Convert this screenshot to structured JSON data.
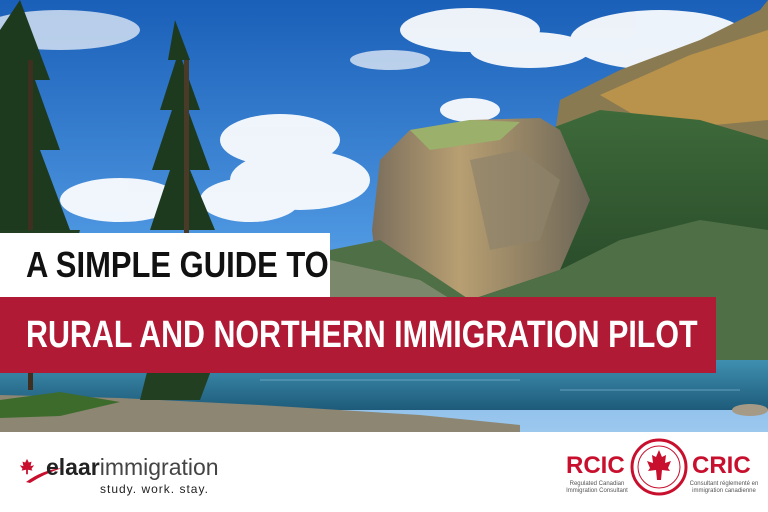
{
  "title": {
    "line1": "A SIMPLE GUIDE TO",
    "line2": "RURAL AND NORTHERN IMMIGRATION PILOT"
  },
  "brand": {
    "name_bold": "elaar",
    "name_light": "immigration",
    "tagline": "study. work. stay.",
    "logo_icon": "maple-leaf-icon"
  },
  "badge": {
    "left_word": "RCIC",
    "right_word": "CRIC",
    "left_sub": "Regulated Canadian Immigration Consultant",
    "right_sub": "Consultant réglementé en immigration canadienne",
    "icon": "maple-leaf-icon"
  },
  "colors": {
    "accent_red": "#b01a34",
    "badge_red": "#c8102e"
  }
}
